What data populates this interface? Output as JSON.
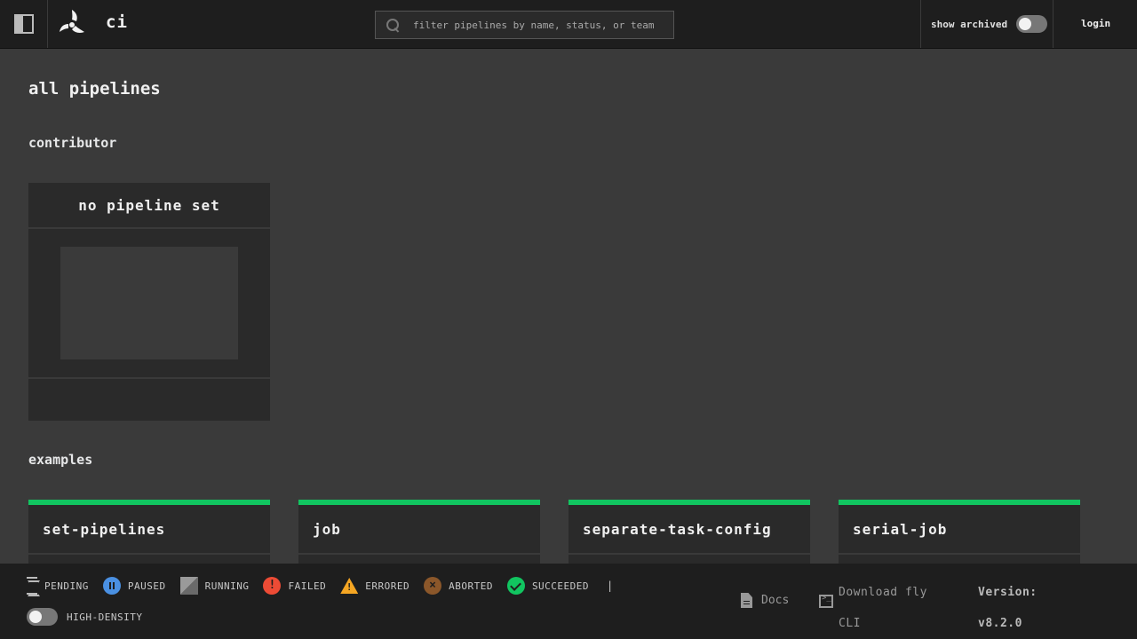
{
  "topbar": {
    "cluster_name": "ci",
    "search_placeholder": "filter pipelines by name, status, or team",
    "show_archived_label": "show archived",
    "login_label": "login"
  },
  "main": {
    "page_title": "all pipelines",
    "teams": [
      {
        "name": "contributor",
        "empty_card_label": "no pipeline set"
      },
      {
        "name": "examples",
        "pipelines": [
          "set-pipelines",
          "job",
          "separate-task-config",
          "serial-job"
        ]
      }
    ]
  },
  "footer": {
    "legend": [
      "PENDING",
      "PAUSED",
      "RUNNING",
      "FAILED",
      "ERRORED",
      "ABORTED",
      "SUCCEEDED"
    ],
    "separator": "|",
    "high_density_label": "HIGH-DENSITY",
    "docs_label": "Docs",
    "cli_label": "Download fly CLI",
    "version_label": "Version:",
    "version_value": "v8.2.0"
  },
  "colors": {
    "succeeded": "#11c560",
    "paused": "#4a90e2",
    "failed": "#ed4b35",
    "errored": "#f5a623",
    "aborted": "#8b572a"
  },
  "icons": [
    "sidebar-toggle-icon",
    "concourse-logo",
    "search-icon",
    "document-icon",
    "terminal-icon"
  ]
}
